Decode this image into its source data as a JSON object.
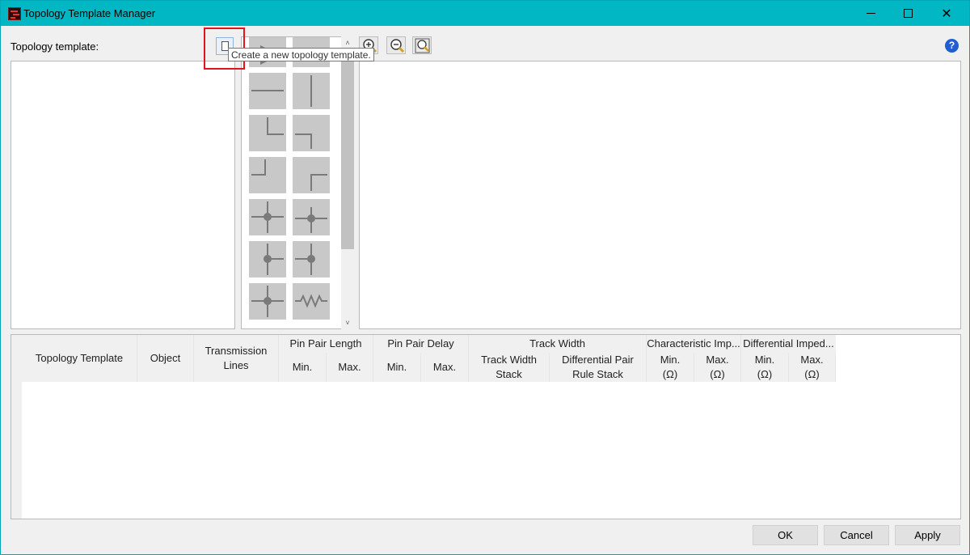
{
  "window": {
    "title": "Topology Template Manager"
  },
  "toolbar": {
    "template_label": "Topology template:",
    "new_template_tooltip": "Create a new topology template."
  },
  "palette": {
    "tiles": [
      "triangle-source-icon",
      "receiver-shape-icon",
      "horizontal-line-icon",
      "vertical-line-icon",
      "corner-down-right-icon",
      "corner-down-left-icon",
      "corner-up-left-icon",
      "corner-up-right-icon",
      "tee-junction-icon",
      "tee-junction-offset-icon",
      "tee-junction-left-icon",
      "tee-junction-right-icon",
      "cross-junction-icon",
      "resistor-icon"
    ],
    "scroll_up": "˄",
    "scroll_down": "˅"
  },
  "view_tools": [
    "zoom-in-icon",
    "zoom-out-icon",
    "zoom-fit-icon"
  ],
  "help": {
    "label": "?"
  },
  "grid": {
    "headers": {
      "topology_template": "Topology Template",
      "object": "Object",
      "transmission_lines": "Transmission Lines",
      "pin_pair_length": "Pin Pair Length",
      "pin_pair_delay": "Pin Pair Delay",
      "track_width": "Track Width",
      "track_width_stack": "Track Width Stack",
      "differential_pair_rule_stack": "Differential Pair Rule Stack",
      "characteristic_imp": "Characteristic Imp...",
      "differential_imped": "Differential Imped...",
      "min": "Min.",
      "max": "Max.",
      "min_ohm": "Min. (Ω)",
      "max_ohm": "Max. (Ω)"
    },
    "rows": []
  },
  "buttons": {
    "ok": "OK",
    "cancel": "Cancel",
    "apply": "Apply"
  },
  "colors": {
    "titlebar": "#00b7c3",
    "highlight": "#e3151b",
    "help": "#1f5fd0"
  }
}
